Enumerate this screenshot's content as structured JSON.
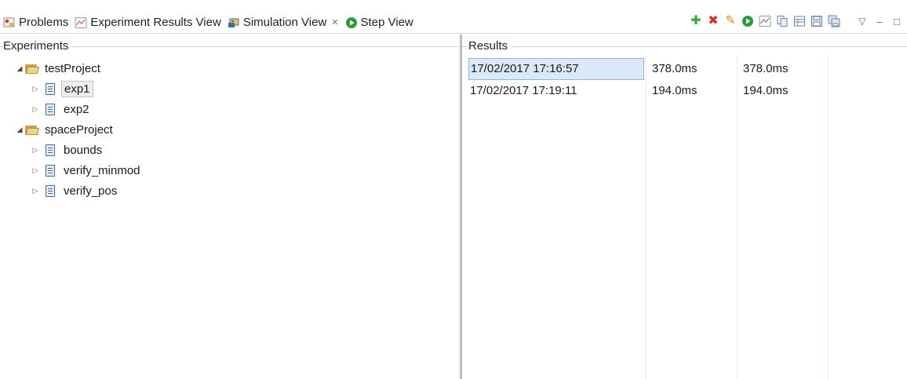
{
  "tabs": [
    {
      "label": "Problems",
      "icon": "problems-icon",
      "active": false
    },
    {
      "label": "Experiment Results View",
      "icon": "chart-icon",
      "active": false
    },
    {
      "label": "Simulation View",
      "icon": "simulation-icon",
      "active": true,
      "close": "✕"
    },
    {
      "label": "Step View",
      "icon": "run-icon",
      "active": false
    }
  ],
  "toolbar": {
    "add": "✚",
    "delete": "✖",
    "edit": "✎",
    "run": "▶",
    "menu": "▽",
    "minimize": "–",
    "maximize": "□"
  },
  "experiments_panel": {
    "title": "Experiments",
    "tree": [
      {
        "label": "testProject",
        "type": "folder",
        "expanded": true,
        "children": [
          {
            "label": "exp1",
            "type": "doc",
            "selected": true
          },
          {
            "label": "exp2",
            "type": "doc",
            "selected": false
          }
        ]
      },
      {
        "label": "spaceProject",
        "type": "folder",
        "expanded": true,
        "children": [
          {
            "label": "bounds",
            "type": "doc",
            "selected": false
          },
          {
            "label": "verify_minmod",
            "type": "doc",
            "selected": false
          },
          {
            "label": "verify_pos",
            "type": "doc",
            "selected": false
          }
        ]
      }
    ]
  },
  "results_panel": {
    "title": "Results",
    "rows": [
      {
        "timestamp": "17/02/2017  17:16:57",
        "time1": "378.0ms",
        "time2": "378.0ms",
        "selected": true
      },
      {
        "timestamp": "17/02/2017  17:19:11",
        "time1": "194.0ms",
        "time2": "194.0ms",
        "selected": false
      }
    ]
  },
  "colors": {
    "add": "#3aa83a",
    "delete": "#d93025",
    "edit": "#d9822b",
    "run": "#2e9a3e",
    "selection": "#dbe9f7"
  }
}
